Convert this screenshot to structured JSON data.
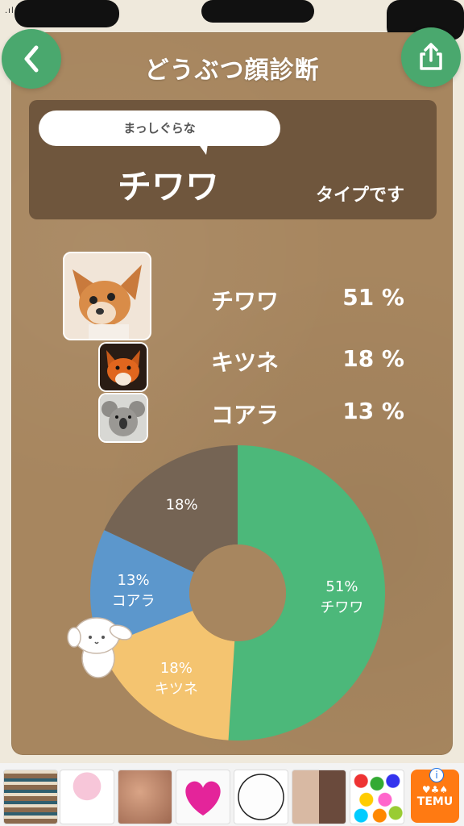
{
  "header": {
    "title": "どうぶつ顔診断",
    "back_icon": "chevron-left-icon",
    "share_icon": "share-icon"
  },
  "result": {
    "bubble": "まっしぐらな",
    "animal": "チワワ",
    "suffix": "タイプです"
  },
  "ranking": [
    {
      "name": "チワワ",
      "percent": "51 %"
    },
    {
      "name": "キツネ",
      "percent": "18 %"
    },
    {
      "name": "コアラ",
      "percent": "13 %"
    }
  ],
  "chart_data": {
    "type": "pie",
    "categories": [
      "チワワ",
      "キツネ",
      "コアラ",
      ""
    ],
    "values": [
      51,
      18,
      13,
      18
    ],
    "labels": [
      "51%\nチワワ",
      "18%\nキツネ",
      "13%\nコアラ",
      "18%"
    ],
    "colors": [
      "#4cb87a",
      "#f4c470",
      "#5c97cc",
      "#756454"
    ]
  },
  "ads": {
    "temu_label": "TEMU",
    "info_label": "i"
  },
  "colors": {
    "accent": "#4aa86e",
    "board": "#a7865f",
    "result_box": "#6f563d"
  }
}
